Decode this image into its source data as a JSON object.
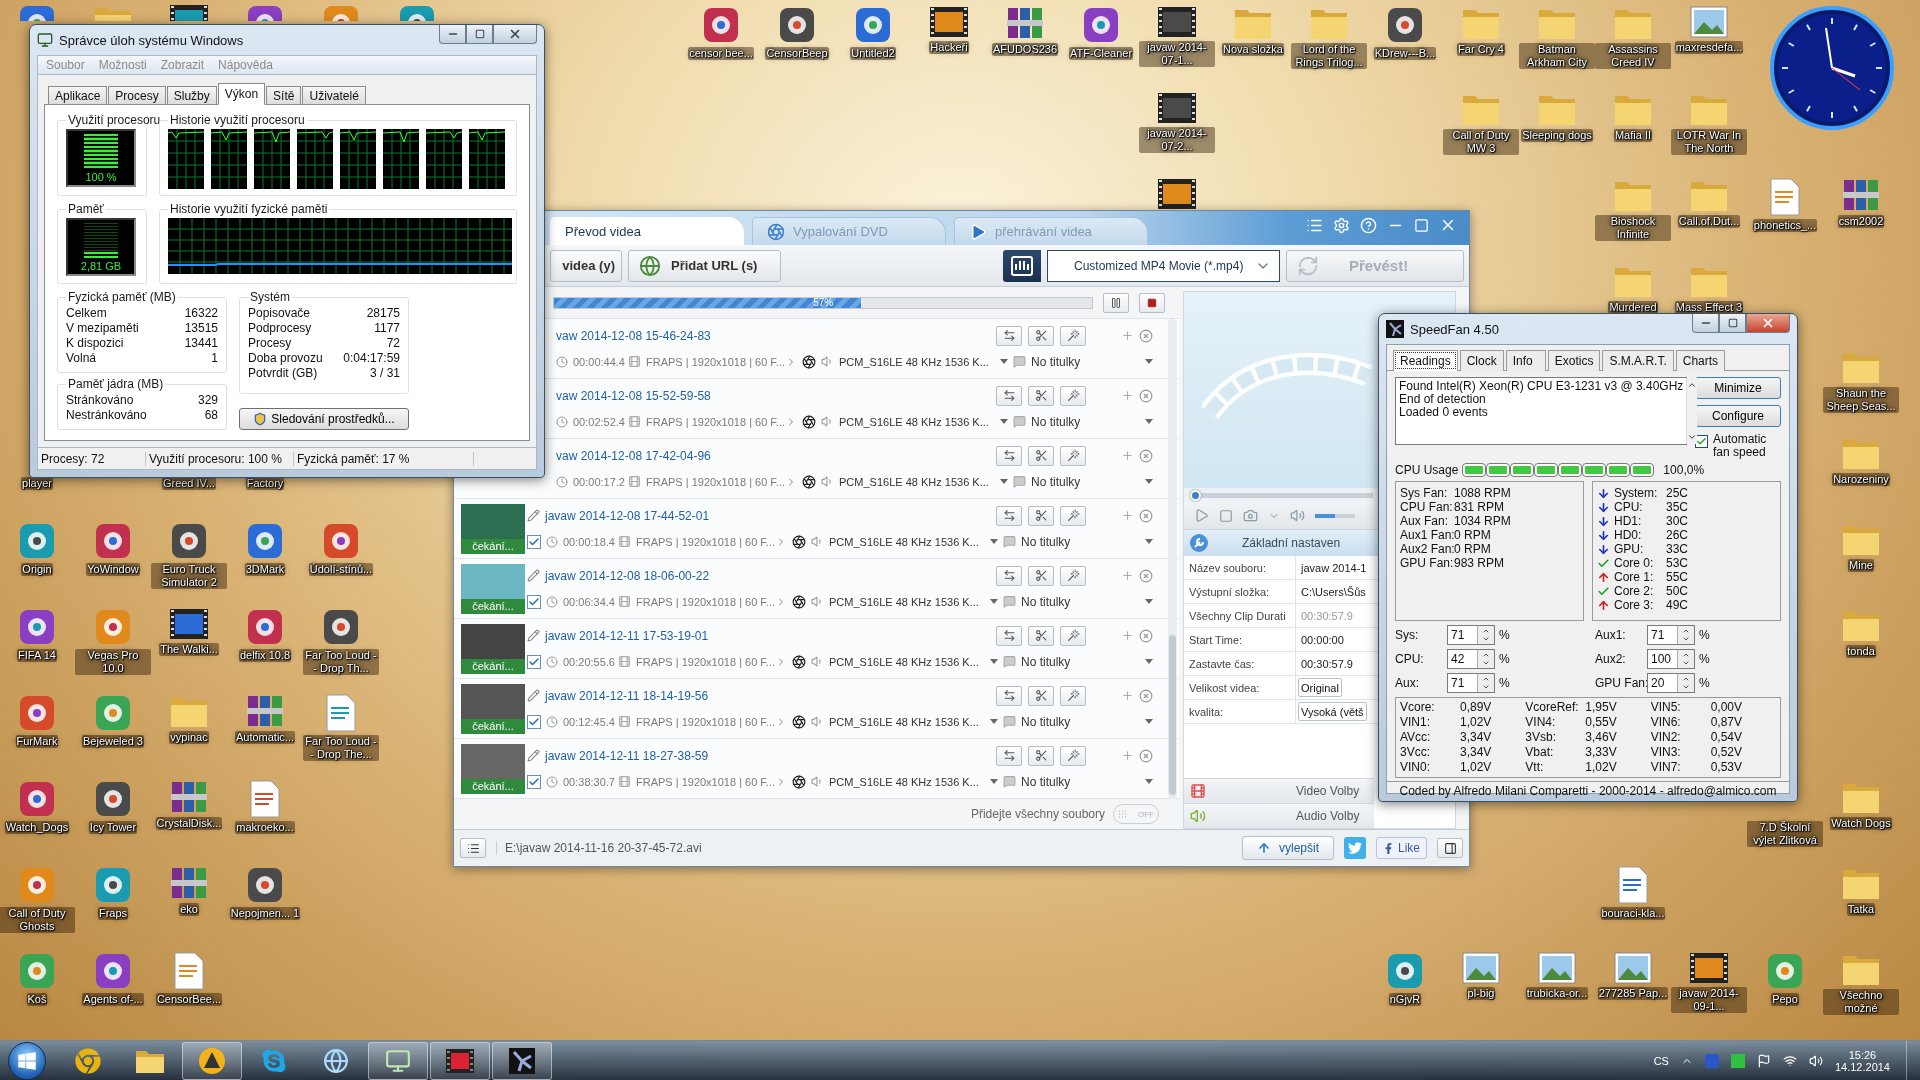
{
  "desktop": {
    "icons": [
      {
        "kind": "app"
      },
      {
        "kind": "folder"
      },
      {
        "kind": "video"
      },
      {
        "kind": "app"
      },
      {
        "kind": "app"
      },
      {
        "kind": "app"
      },
      {
        "label": "censor bee...",
        "kind": "app"
      },
      {
        "label": "CensorBeep",
        "kind": "app"
      },
      {
        "label": "Untitled2",
        "kind": "app"
      },
      {
        "label": "Hackeři",
        "kind": "video"
      },
      {
        "label": "AFUDOS236",
        "kind": "archive"
      },
      {
        "label": "ATF-Cleaner",
        "kind": "app"
      },
      {
        "label": "javaw 2014-07-1...",
        "kind": "video"
      },
      {
        "label": "Nova složka",
        "kind": "folder"
      },
      {
        "label": "Lord of the Rings Trilog...",
        "kind": "folder"
      },
      {
        "label": "KDrew---B...",
        "kind": "app"
      },
      {
        "label": "Far Cry 4",
        "kind": "folder"
      },
      {
        "label": "Batman Arkham City",
        "kind": "folder"
      },
      {
        "label": "Assassins Creed IV",
        "kind": "folder"
      },
      {
        "label": "maxresdefa...",
        "kind": "image"
      },
      {
        "label": "javaw 2014-07-2...",
        "kind": "video"
      },
      {
        "label": "Call of Duty MW 3",
        "kind": "folder"
      },
      {
        "label": "Sleeping dogs",
        "kind": "folder"
      },
      {
        "label": "Mafia II",
        "kind": "folder"
      },
      {
        "label": "LOTR War In The North",
        "kind": "folder"
      },
      {
        "kind": "video"
      },
      {
        "label": "Bioshock Infinite",
        "kind": "folder"
      },
      {
        "label": "Call.of.Dut...",
        "kind": "folder"
      },
      {
        "label": "phonetics_...",
        "kind": "file"
      },
      {
        "label": "csm2002",
        "kind": "archive"
      },
      {
        "label": "Murdered",
        "kind": "folder"
      },
      {
        "label": "Mass Effect 3",
        "kind": "folder"
      },
      {
        "label": "Shaun the Sheep Seas...",
        "kind": "folder"
      },
      {
        "label": "player"
      },
      {
        "label": "Greed IV..."
      },
      {
        "label": "Factory"
      },
      {
        "label": "Narozeniny",
        "kind": "folder"
      },
      {
        "label": "Origin",
        "kind": "app"
      },
      {
        "label": "YoWindow",
        "kind": "app"
      },
      {
        "label": "Euro Truck Simulator 2",
        "kind": "app"
      },
      {
        "label": "3DMark",
        "kind": "app"
      },
      {
        "label": "Údolí-stínů...",
        "kind": "app"
      },
      {
        "label": "Mine",
        "kind": "folder"
      },
      {
        "label": "FIFA 14",
        "kind": "app"
      },
      {
        "label": "Vegas Pro 10.0",
        "kind": "app"
      },
      {
        "label": "The Walki...",
        "kind": "video"
      },
      {
        "label": "delfix 10.8",
        "kind": "app"
      },
      {
        "label": "Far Too Loud -- Drop Th...",
        "kind": "app"
      },
      {
        "label": "tonda",
        "kind": "folder"
      },
      {
        "label": "FurMark",
        "kind": "app"
      },
      {
        "label": "Bejeweled 3",
        "kind": "app"
      },
      {
        "label": "vypinac",
        "kind": "folder"
      },
      {
        "label": "Automatic...",
        "kind": "archive"
      },
      {
        "label": "Far Too Loud -- Drop The...",
        "kind": "file"
      },
      {
        "label": "Watch_Dogs",
        "kind": "app"
      },
      {
        "label": "Icy Tower",
        "kind": "app"
      },
      {
        "label": "CrystalDisk...",
        "kind": "archive"
      },
      {
        "label": "makroeko...",
        "kind": "file"
      },
      {
        "label": "7.D Školní výlet Zlitková"
      },
      {
        "label": "Watch Dogs",
        "kind": "folder"
      },
      {
        "label": "Call of Duty Ghosts",
        "kind": "app"
      },
      {
        "label": "Fraps",
        "kind": "app"
      },
      {
        "label": "eko",
        "kind": "archive"
      },
      {
        "label": "Nepojmen... 1",
        "kind": "app"
      },
      {
        "label": "bouraci-kla...",
        "kind": "file"
      },
      {
        "label": "Tatka",
        "kind": "folder"
      },
      {
        "label": "Koš",
        "kind": "app"
      },
      {
        "label": "Agents of-...",
        "kind": "app"
      },
      {
        "label": "CensorBee...",
        "kind": "file"
      },
      {
        "label": "nGjvR",
        "kind": "app"
      },
      {
        "label": "pl-big",
        "kind": "image"
      },
      {
        "label": "trubicka-or...",
        "kind": "image"
      },
      {
        "label": "277285 Pap...",
        "kind": "image"
      },
      {
        "label": "javaw 2014-09-1...",
        "kind": "video"
      },
      {
        "label": "Pepo",
        "kind": "app"
      },
      {
        "label": "Všechno možné",
        "kind": "folder"
      }
    ]
  },
  "task_manager": {
    "title": "Správce úloh systému Windows",
    "menu": [
      "Soubor",
      "Možnosti",
      "Zobrazit",
      "Nápověda"
    ],
    "tabs": [
      {
        "label": "Aplikace",
        "selected": false
      },
      {
        "label": "Procesy",
        "selected": false
      },
      {
        "label": "Služby",
        "selected": false
      },
      {
        "label": "Výkon",
        "selected": true
      },
      {
        "label": "Sítě",
        "selected": false
      },
      {
        "label": "Uživatelé",
        "selected": false
      }
    ],
    "cpu": {
      "title": "Využití procesoru",
      "reading": "100 %",
      "level": 1
    },
    "cpu_history": {
      "title": "Historie využití procesoru"
    },
    "memory": {
      "title": "Paměť",
      "reading": "2,81 GB",
      "level": 0.17
    },
    "memory_history": {
      "title": "Historie využití fyzické paměti"
    },
    "physical": {
      "title": "Fyzická paměť (MB)",
      "rows": [
        {
          "label": "Celkem",
          "value": "16322"
        },
        {
          "label": "V mezipaměti",
          "value": "13515"
        },
        {
          "label": "K dispozici",
          "value": "13441"
        },
        {
          "label": "Volná",
          "value": "1"
        }
      ]
    },
    "kernel": {
      "title": "Paměť jádra (MB)",
      "rows": [
        {
          "label": "Stránkováno",
          "value": "329"
        },
        {
          "label": "Nestránkováno",
          "value": "68"
        }
      ]
    },
    "system": {
      "title": "Systém",
      "rows": [
        {
          "label": "Popisovače",
          "value": "28175"
        },
        {
          "label": "Podprocesy",
          "value": "1177"
        },
        {
          "label": "Procesy",
          "value": "72"
        },
        {
          "label": "Doba provozu",
          "value": "0:04:17:59"
        },
        {
          "label": "Potvrdit (GB)",
          "value": "3 / 31"
        }
      ]
    },
    "resource_button": "Sledování prostředků...",
    "status": [
      "Procesy: 72",
      "Využití procesoru: 100 %",
      "Fyzická paměť: 17 %"
    ]
  },
  "converter": {
    "tabs": [
      {
        "label": "Převod videa",
        "selected": true
      },
      {
        "label": "Vypalování DVD",
        "selected": false
      },
      {
        "label": "přehrávání videa",
        "selected": false
      }
    ],
    "toolbar": {
      "add_video": "videa (y)",
      "add_url": "Přidat URL (s)",
      "format": "Customized MP4 Movie (*.mp4)",
      "convert": {
        "label": "Převést!",
        "disabled": true
      }
    },
    "progress": {
      "level": 0.57,
      "reading": "57%"
    },
    "files": [
      {
        "name": "vaw 2014-12-08 15-46-24-83",
        "duration": "00:00:44.4",
        "video": "FRAPS | 1920x1018 | 60 F...",
        "audio": "PCM_S16LE 48 KHz 1536 K...",
        "subtitles": "No titulky"
      },
      {
        "name": "vaw 2014-12-08 15-52-59-58",
        "duration": "00:02:52.4",
        "video": "FRAPS | 1920x1018 | 60 F...",
        "audio": "PCM_S16LE 48 KHz 1536 K...",
        "subtitles": "No titulky"
      },
      {
        "name": "vaw 2014-12-08 17-42-04-96",
        "duration": "00:00:17.2",
        "video": "FRAPS | 1920x1018 | 60 F...",
        "audio": "PCM_S16LE 48 KHz 1536 K...",
        "subtitles": "No titulky"
      },
      {
        "name": "javaw 2014-12-08 17-44-52-01",
        "status": "čekání...",
        "checked": true,
        "duration": "00:00:18.4",
        "video": "FRAPS | 1920x1018 | 60 F...",
        "audio": "PCM_S16LE 48 KHz 1536 K...",
        "subtitles": "No titulky"
      },
      {
        "name": "javaw 2014-12-08 18-06-00-22",
        "status": "čekání...",
        "checked": true,
        "duration": "00:06:34.4",
        "video": "FRAPS | 1920x1018 | 60 F...",
        "audio": "PCM_S16LE 48 KHz 1536 K...",
        "subtitles": "No titulky"
      },
      {
        "name": "javaw 2014-12-11 17-53-19-01",
        "status": "čekání...",
        "checked": true,
        "duration": "00:20:55.6",
        "video": "FRAPS | 1920x1018 | 60 F...",
        "audio": "PCM_S16LE 48 KHz 1536 K...",
        "subtitles": "No titulky"
      },
      {
        "name": "javaw 2014-12-11 18-14-19-56",
        "status": "čekání...",
        "checked": true,
        "duration": "00:12:45.4",
        "video": "FRAPS | 1920x1018 | 60 F...",
        "audio": "PCM_S16LE 48 KHz 1536 K...",
        "subtitles": "No titulky"
      },
      {
        "name": "javaw 2014-12-11 18-27-38-59",
        "status": "čekání...",
        "checked": true,
        "duration": "00:38:30.7",
        "video": "FRAPS | 1920x1018 | 60 F...",
        "audio": "PCM_S16LE 48 KHz 1536 K...",
        "subtitles": "No titulky"
      }
    ],
    "add_all": {
      "label": "Přidejte všechny soubory",
      "toggle": "OFF",
      "on": false
    },
    "seek": {
      "level": 0
    },
    "volume": {
      "level": 0.5
    },
    "settings": {
      "title": "Základní nastaven",
      "rows": [
        {
          "label": "Název souboru:",
          "value": "javaw 2014-1",
          "kind": "text"
        },
        {
          "label": "Výstupní složka:",
          "value": "C:\\Users\\Šůs",
          "kind": "text"
        },
        {
          "label": "Všechny Clip Durati",
          "value": "00:30:57.9",
          "kind": "readonly"
        },
        {
          "label": "Start Time:",
          "value": "00:00:00",
          "kind": "text"
        },
        {
          "label": "Zastavte čas:",
          "value": "00:30:57.9",
          "kind": "text"
        },
        {
          "label": "Velikost videa:",
          "value": "Original",
          "kind": "select"
        },
        {
          "label": "kvalita:",
          "value": "Vysoká (větš",
          "kind": "select"
        }
      ]
    },
    "sections": [
      {
        "label": "Video Volby",
        "kind": "video"
      },
      {
        "label": "Audio Volby",
        "kind": "audio"
      }
    ],
    "status_bar": {
      "path": "E:\\javaw 2014-11-16 20-37-45-72.avi",
      "upgrade": "vylepšit",
      "like": "Like"
    }
  },
  "speedfan": {
    "title": "SpeedFan 4.50",
    "tabs": [
      {
        "label": "Readings",
        "selected": true
      },
      {
        "label": "Clock",
        "selected": false
      },
      {
        "label": "Info",
        "selected": false
      },
      {
        "label": "Exotics",
        "selected": false
      },
      {
        "label": "S.M.A.R.T.",
        "selected": false
      },
      {
        "label": "Charts",
        "selected": false
      }
    ],
    "log": [
      "Found Intel(R) Xeon(R) CPU E3-1231 v3 @ 3.40GHz",
      "End of detection",
      "Loaded 0 events"
    ],
    "buttons": [
      "Minimize",
      "Configure"
    ],
    "auto_fan": {
      "label": "Automatic fan speed",
      "checked": true
    },
    "cpu_usage": {
      "label": "CPU Usage",
      "reading": "100,0%",
      "cores": [
        {
          "level": 1
        },
        {
          "level": 1
        },
        {
          "level": 1
        },
        {
          "level": 1
        },
        {
          "level": 1
        },
        {
          "level": 1
        },
        {
          "level": 1
        },
        {
          "level": 1
        }
      ]
    },
    "fans": [
      {
        "name": "Sys Fan:",
        "value": "1088 RPM"
      },
      {
        "name": "CPU Fan:",
        "value": "831 RPM"
      },
      {
        "name": "Aux Fan:",
        "value": "1034 RPM"
      },
      {
        "name": "Aux1 Fan:",
        "value": "0 RPM"
      },
      {
        "name": "Aux2 Fan:",
        "value": "0 RPM"
      },
      {
        "name": "GPU Fan:",
        "value": "983 RPM"
      }
    ],
    "temps": [
      {
        "name": "System:",
        "value": "25C",
        "kind": "down"
      },
      {
        "name": "CPU:",
        "value": "35C",
        "kind": "down"
      },
      {
        "name": "HD1:",
        "value": "30C",
        "kind": "down"
      },
      {
        "name": "HD0:",
        "value": "26C",
        "kind": "down"
      },
      {
        "name": "GPU:",
        "value": "33C",
        "kind": "down"
      },
      {
        "name": "Core 0:",
        "value": "53C",
        "kind": "ok"
      },
      {
        "name": "Core 1:",
        "value": "55C",
        "kind": "up"
      },
      {
        "name": "Core 2:",
        "value": "50C",
        "kind": "ok"
      },
      {
        "name": "Core 3:",
        "value": "49C",
        "kind": "up"
      }
    ],
    "speeds": [
      {
        "label": "Sys:",
        "value": "71",
        "unit": "%"
      },
      {
        "label": "Aux1:",
        "value": "71",
        "unit": "%"
      },
      {
        "label": "CPU:",
        "value": "42",
        "unit": "%"
      },
      {
        "label": "Aux2:",
        "value": "100",
        "unit": "%"
      },
      {
        "label": "Aux:",
        "value": "71",
        "unit": "%"
      },
      {
        "label": "GPU Fan:",
        "value": "20",
        "unit": "%"
      }
    ],
    "voltages": [
      {
        "name": "Vcore:",
        "value": "0,89V"
      },
      {
        "name": "VcoreRef:",
        "value": "1,95V"
      },
      {
        "name": "VIN5:",
        "value": "0,00V"
      },
      {
        "name": "VIN1:",
        "value": "1,02V"
      },
      {
        "name": "VIN4:",
        "value": "0,55V"
      },
      {
        "name": "VIN6:",
        "value": "0,87V"
      },
      {
        "name": "AVcc:",
        "value": "3,34V"
      },
      {
        "name": "3Vsb:",
        "value": "3,46V"
      },
      {
        "name": "VIN2:",
        "value": "0,54V"
      },
      {
        "name": "3Vcc:",
        "value": "3,34V"
      },
      {
        "name": "Vbat:",
        "value": "3,33V"
      },
      {
        "name": "VIN3:",
        "value": "0,52V"
      },
      {
        "name": "VIN0:",
        "value": "1,02V"
      },
      {
        "name": "Vtt:",
        "value": "1,02V"
      },
      {
        "name": "VIN7:",
        "value": "0,53V"
      }
    ],
    "footer": "Coded by Alfredo Milani Comparetti - 2000-2014 - alfredo@almico.com"
  },
  "taskbar": {
    "items": [
      {
        "kind": "browser",
        "running": false
      },
      {
        "kind": "folder",
        "running": false
      },
      {
        "kind": "player",
        "running": true
      },
      {
        "kind": "chat",
        "running": false
      },
      {
        "kind": "globe",
        "running": false
      },
      {
        "kind": "monitor",
        "running": true
      },
      {
        "kind": "film",
        "running": true
      },
      {
        "kind": "fan",
        "running": true
      }
    ],
    "language": "CS",
    "time": "15:26",
    "date": "14.12.2014"
  }
}
